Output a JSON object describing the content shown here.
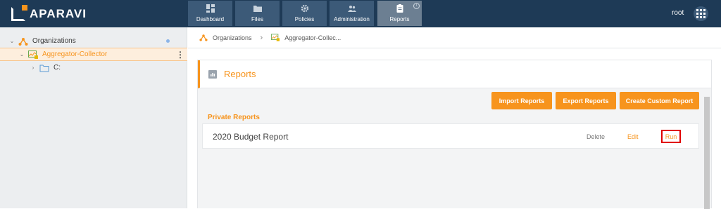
{
  "app": {
    "brand": "APARAVI",
    "user": "root"
  },
  "nav": {
    "tabs": [
      {
        "label": "Dashboard",
        "icon": "dashboard-icon"
      },
      {
        "label": "Files",
        "icon": "folder-icon"
      },
      {
        "label": "Policies",
        "icon": "gear-icon"
      },
      {
        "label": "Administration",
        "icon": "users-icon"
      },
      {
        "label": "Reports",
        "icon": "clipboard-icon",
        "active": true
      }
    ]
  },
  "sidebar": {
    "items": [
      {
        "label": "Organizations",
        "level": 0,
        "icon": "organizations-icon"
      },
      {
        "label": "Aggregator-Collector",
        "level": 1,
        "icon": "aggregator-icon",
        "selected": true
      },
      {
        "label": "C:",
        "level": 2,
        "icon": "folder-icon"
      }
    ]
  },
  "breadcrumb": {
    "items": [
      "Organizations",
      "Aggregator-Collec..."
    ]
  },
  "reports": {
    "title": "Reports",
    "buttons": {
      "import": "Import Reports",
      "export": "Export Reports",
      "create": "Create Custom Report"
    },
    "section": "Private Reports",
    "rows": [
      {
        "name": "2020 Budget Report",
        "delete": "Delete",
        "edit": "Edit",
        "run": "Run"
      }
    ]
  },
  "colors": {
    "accent": "#f7941d",
    "topbar": "#1e3a56",
    "tab": "#3c5a78",
    "tab_active": "#6c7f92",
    "highlight": "#e00000"
  }
}
